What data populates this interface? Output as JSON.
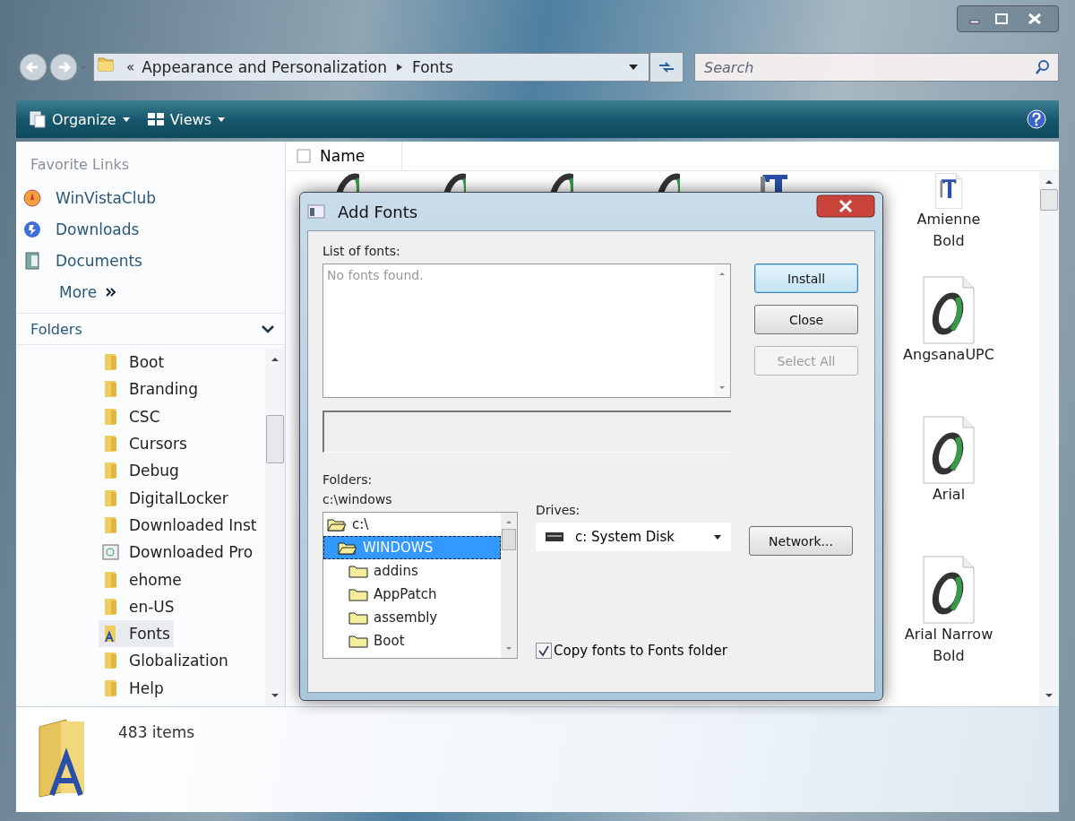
{
  "address_bar": {
    "overflow": "«",
    "crumbs": [
      "Appearance and Personalization",
      "Fonts"
    ]
  },
  "search": {
    "placeholder": "Search"
  },
  "toolbar": [
    {
      "label": "Organize",
      "kind": "organize"
    },
    {
      "label": "Views",
      "kind": "views"
    }
  ],
  "favorite_links": {
    "heading": "Favorite Links",
    "items": [
      {
        "label": "WinVistaClub",
        "kind": "club"
      },
      {
        "label": "Downloads",
        "kind": "downloads"
      },
      {
        "label": "Documents",
        "kind": "documents"
      }
    ],
    "more": "More"
  },
  "folders": {
    "heading": "Folders",
    "items": [
      {
        "label": "Boot",
        "kind": "folder",
        "selected": false
      },
      {
        "label": "Branding",
        "kind": "folder",
        "selected": false
      },
      {
        "label": "CSC",
        "kind": "folder",
        "selected": false
      },
      {
        "label": "Cursors",
        "kind": "folder",
        "selected": false
      },
      {
        "label": "Debug",
        "kind": "folder",
        "selected": false
      },
      {
        "label": "DigitalLocker",
        "kind": "folder",
        "selected": false
      },
      {
        "label": "Downloaded Inst",
        "kind": "folder",
        "selected": false
      },
      {
        "label": "Downloaded Pro",
        "kind": "program",
        "selected": false
      },
      {
        "label": "ehome",
        "kind": "folder",
        "selected": false
      },
      {
        "label": "en-US",
        "kind": "folder",
        "selected": false
      },
      {
        "label": "Fonts",
        "kind": "fonts",
        "selected": true
      },
      {
        "label": "Globalization",
        "kind": "folder",
        "selected": false
      },
      {
        "label": "Help",
        "kind": "folder",
        "selected": false
      }
    ]
  },
  "file_list": {
    "column": "Name",
    "covered_items": [
      {
        "kind": "opentype"
      },
      {
        "kind": "opentype"
      },
      {
        "kind": "opentype"
      },
      {
        "kind": "opentype"
      },
      {
        "kind": "truetype"
      }
    ],
    "items": [
      {
        "name": "Amienne Bold",
        "kind": "truetype"
      },
      {
        "name": "AngsanaUPC",
        "kind": "opentype"
      },
      {
        "name": "Arial",
        "kind": "opentype"
      },
      {
        "name": "Arial Narrow Bold",
        "kind": "opentype"
      }
    ]
  },
  "dialog": {
    "title": "Add Fonts",
    "list_label": "List of fonts:",
    "list_text": "No fonts found.",
    "buttons": [
      {
        "label": "Install",
        "default": true,
        "disabled": false
      },
      {
        "label": "Close",
        "default": false,
        "disabled": false
      },
      {
        "label": "Select All",
        "default": false,
        "disabled": true
      }
    ],
    "folders_label": "Folders:",
    "current_path": "c:\\windows",
    "folder_tree": [
      {
        "label": "c:\\",
        "selected": false,
        "children": [
          {
            "label": "WINDOWS",
            "selected": true,
            "children": [
              {
                "label": "addins",
                "selected": false
              },
              {
                "label": "AppPatch",
                "selected": false
              },
              {
                "label": "assembly",
                "selected": false
              },
              {
                "label": "Boot",
                "selected": false
              }
            ]
          }
        ]
      }
    ],
    "drives_label": "Drives:",
    "drive": "c: System Disk",
    "network_button": "Network...",
    "copy_checkbox": {
      "label": "Copy fonts to Fonts folder",
      "checked": true
    }
  },
  "status_bar": {
    "count": "483 items"
  }
}
